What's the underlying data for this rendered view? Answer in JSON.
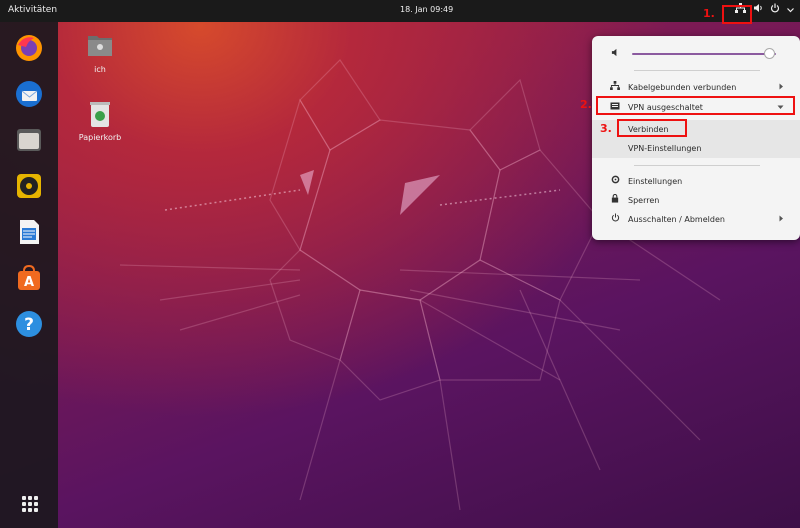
{
  "topbar": {
    "activities": "Aktivitäten",
    "clock": "18. Jan 09:49",
    "tray_icons": [
      "network-icon",
      "volume-icon",
      "power-icon",
      "chevron-down-icon"
    ]
  },
  "dock": {
    "items": [
      "firefox",
      "thunderbird",
      "files",
      "rhythmbox",
      "libreoffice-writer",
      "software-center",
      "help"
    ]
  },
  "desktop": {
    "icons": [
      {
        "label": "ich"
      },
      {
        "label": "Papierkorb"
      }
    ]
  },
  "menu": {
    "volume_level": 0.95,
    "wired": "Kabelgebunden verbunden",
    "vpn": "VPN ausgeschaltet",
    "connect": "Verbinden",
    "vpn_settings": "VPN-Einstellungen",
    "settings": "Einstellungen",
    "lock": "Sperren",
    "power": "Ausschalten / Abmelden"
  },
  "annotations": {
    "step1": "1.",
    "step2": "2.",
    "step3": "3.",
    "color": "#e11111"
  },
  "colors": {
    "accent": "#8b5a9f",
    "topbar": "#1a1a1a"
  }
}
